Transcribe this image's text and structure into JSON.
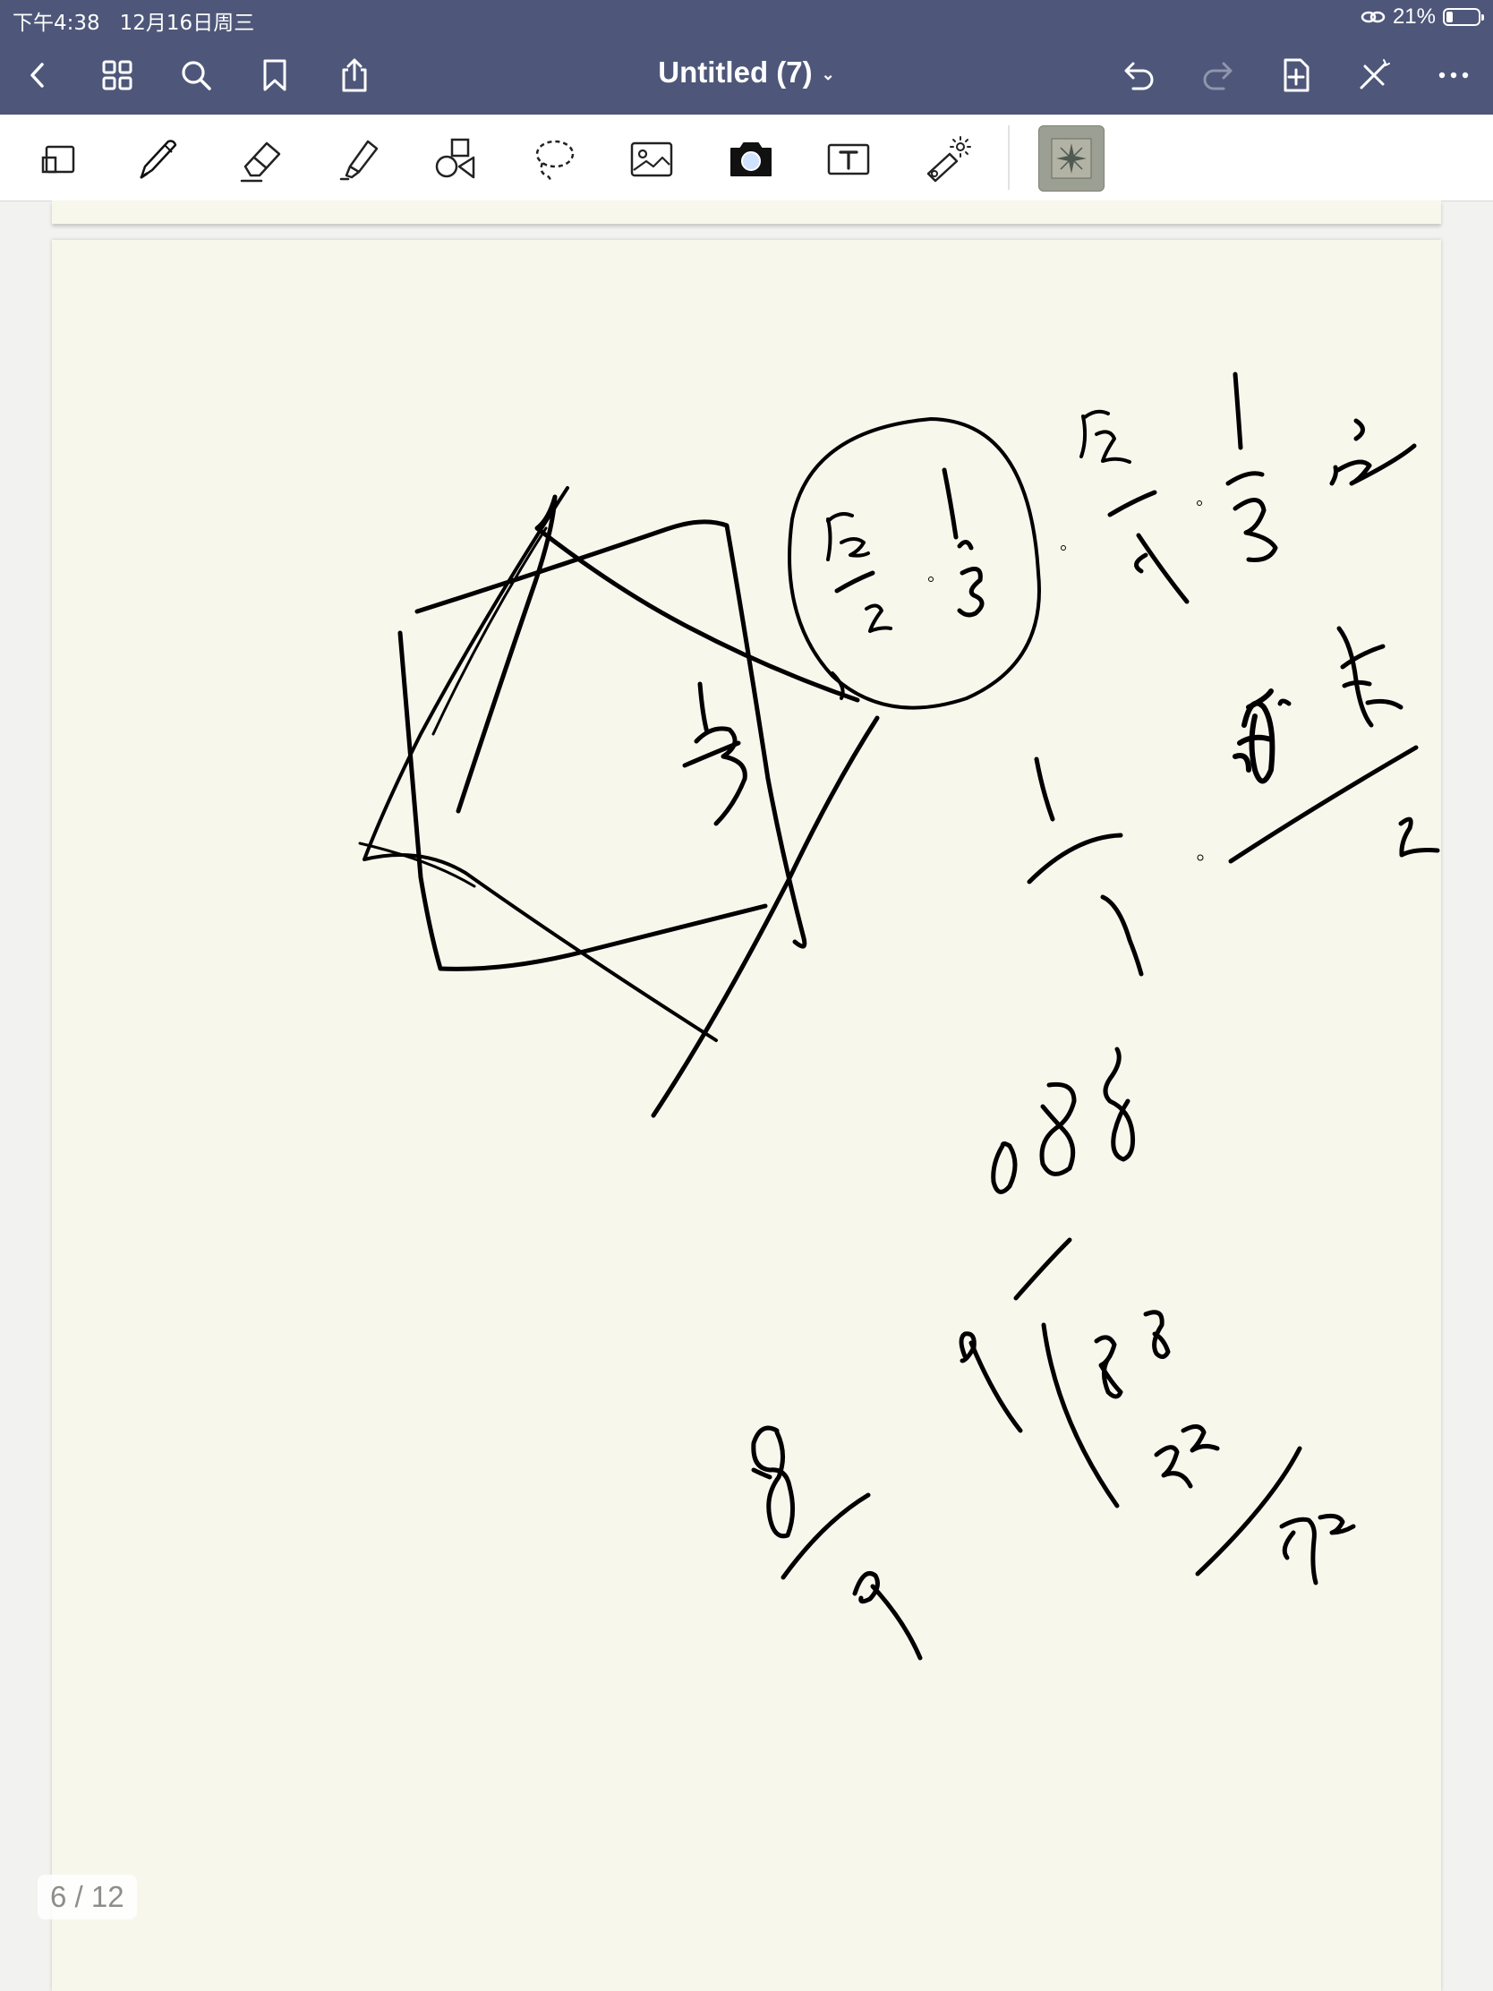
{
  "status_bar": {
    "time": "下午4:38",
    "date": "12月16日周三",
    "battery_percent": "21%",
    "battery_level": 0.21
  },
  "nav": {
    "title": "Untitled (7)",
    "left_icons": [
      "back-icon",
      "grid-icon",
      "search-icon",
      "bookmark-icon",
      "share-icon"
    ],
    "right_icons": [
      "undo-icon",
      "redo-icon",
      "add-page-icon",
      "close-pen-icon",
      "more-icon"
    ]
  },
  "toolbar": {
    "tools": [
      "zoom-window-icon",
      "pen-icon",
      "eraser-icon",
      "highlighter-icon",
      "shapes-icon",
      "lasso-icon",
      "image-icon",
      "camera-icon",
      "text-icon",
      "laser-pointer-icon"
    ],
    "selected_pen_color": "#000000"
  },
  "page": {
    "indicator": "6 / 12",
    "paper_color": "#f8f7ec"
  },
  "colors": {
    "header": "#4e5779",
    "toolbar": "#ffffff",
    "ink": "#000000"
  }
}
